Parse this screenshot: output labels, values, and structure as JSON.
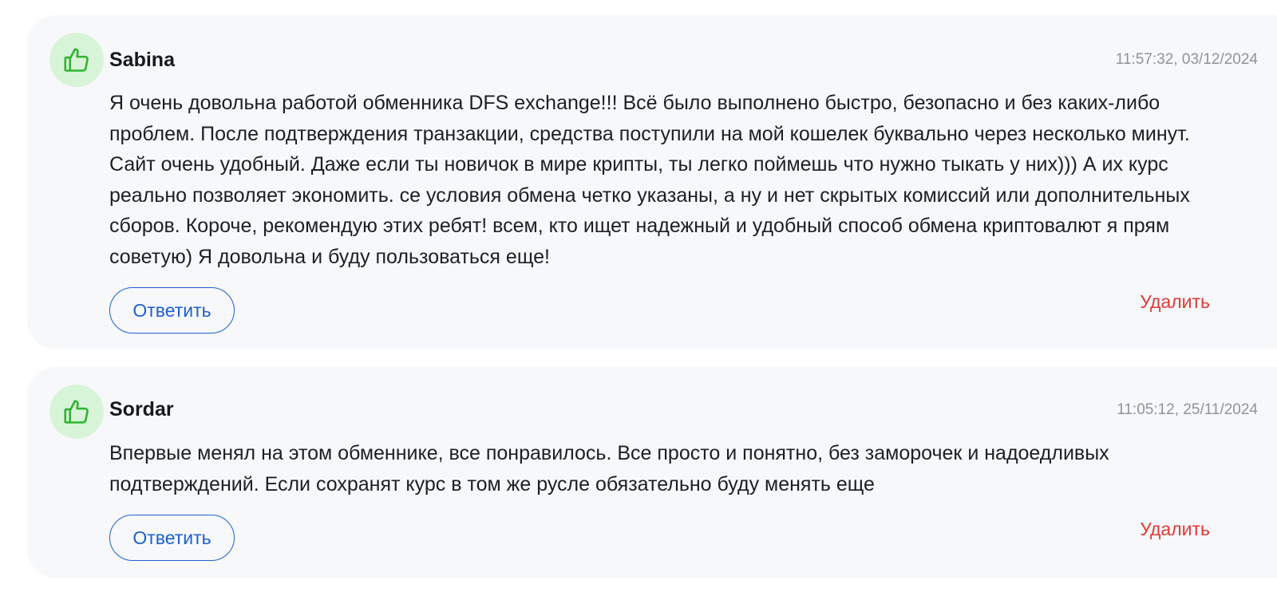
{
  "reviews": [
    {
      "icon": "thumbs-up-icon",
      "author": "Sabina",
      "timestamp": "11:57:32, 03/12/2024",
      "text": "Я очень довольна работой обменника DFS exchange!!! Всё было выполнено быстро, безопасно и без каких-либо проблем. После подтверждения транзакции, средства поступили на мой кошелек буквально через несколько минут. Сайт очень удобный. Даже если ты новичок в мире крипты, ты легко поймешь что нужно тыкать у них))) А их курс реально позволяет экономить. се условия обмена четко указаны, а ну и нет скрытых комиссий или дополнительных сборов. Короче, рекомендую этих ребят! всем, кто ищет надежный и удобный способ обмена криптовалют я прям советую) Я довольна и буду пользоваться еще!",
      "reply_label": "Ответить",
      "delete_label": "Удалить"
    },
    {
      "icon": "thumbs-up-icon",
      "author": "Sordar",
      "timestamp": "11:05:12, 25/11/2024",
      "text": "Впервые менял на этом обменнике, все понравилось. Все просто и понятно, без заморочек и надоедливых подтверждений. Если сохранят курс в том же русле обязательно буду менять еще",
      "reply_label": "Ответить",
      "delete_label": "Удалить"
    }
  ],
  "colors": {
    "card_background": "#f7f8fa",
    "avatar_background": "#d8f4d8",
    "thumbs_up": "#2bb52b",
    "reply_blue": "#1d5fd6",
    "delete_red": "#e53935",
    "timestamp_gray": "#8f939a"
  }
}
